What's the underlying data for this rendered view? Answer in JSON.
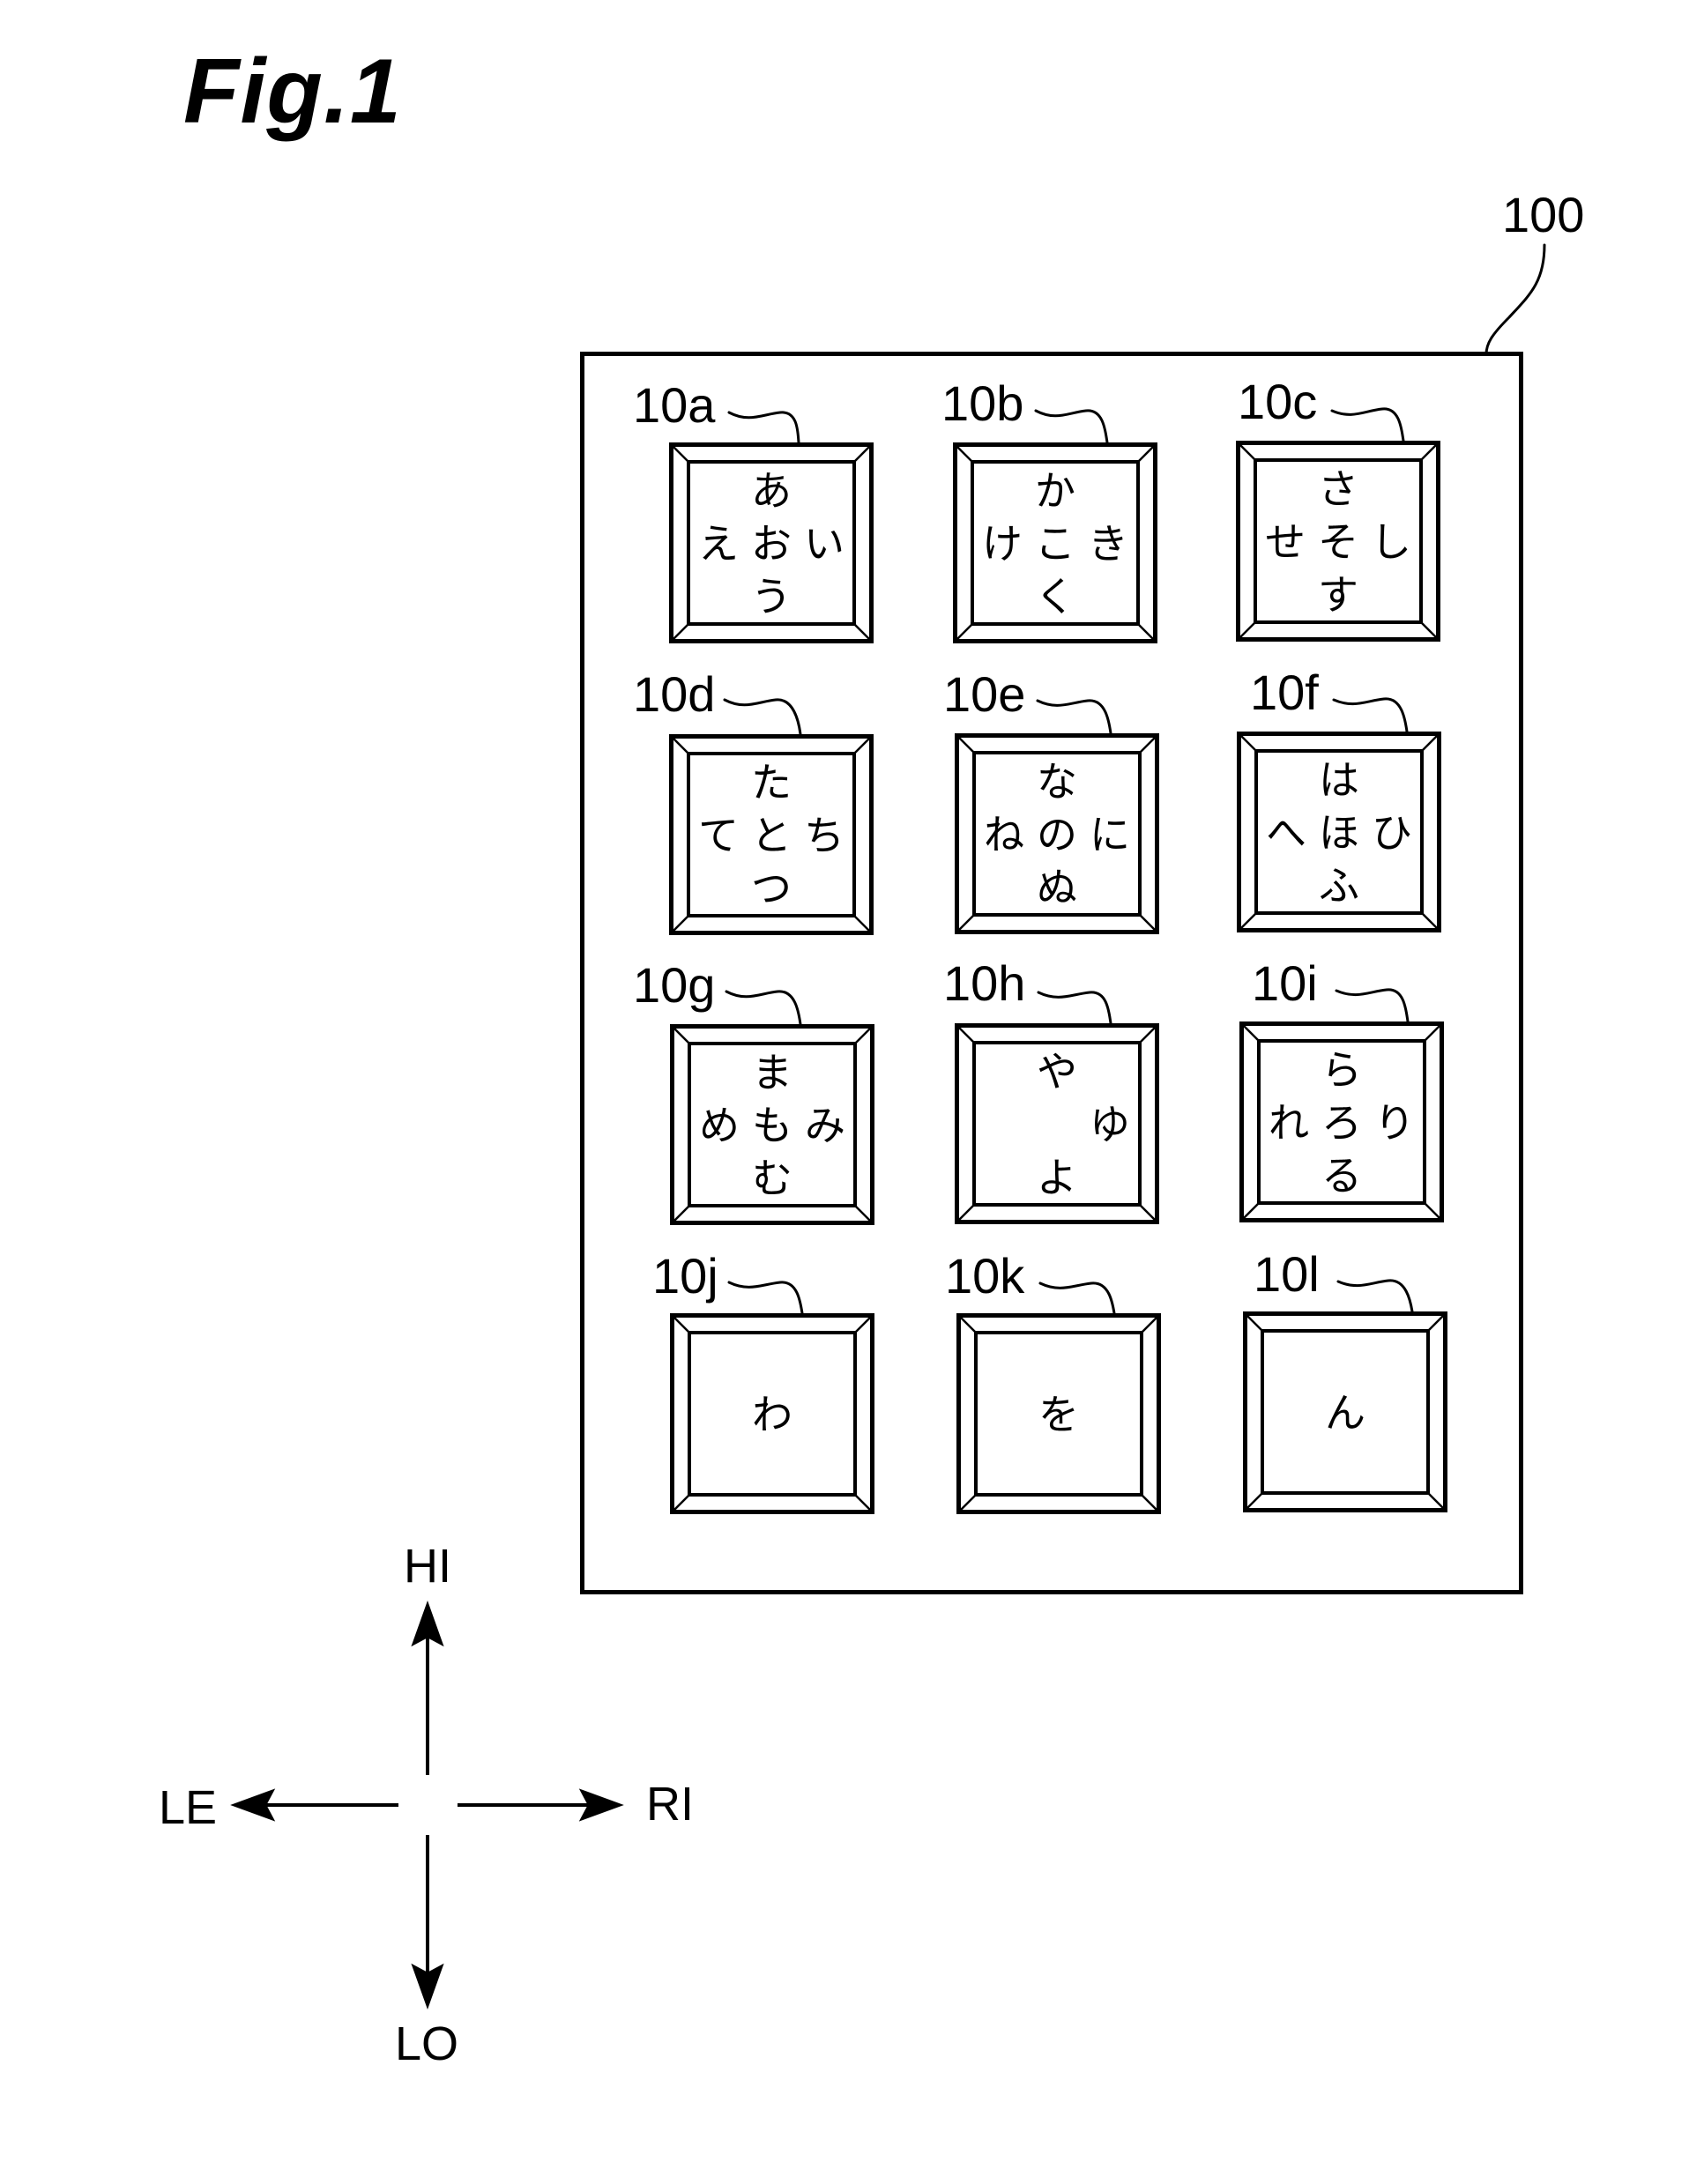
{
  "figure": {
    "title": "Fig.1",
    "board_ref": "100"
  },
  "keys": [
    {
      "ref": "10a",
      "top": "あ",
      "left": "え",
      "center": "お",
      "right": "い",
      "bottom": "う"
    },
    {
      "ref": "10b",
      "top": "か",
      "left": "け",
      "center": "こ",
      "right": "き",
      "bottom": "く"
    },
    {
      "ref": "10c",
      "top": "さ",
      "left": "せ",
      "center": "そ",
      "right": "し",
      "bottom": "す"
    },
    {
      "ref": "10d",
      "top": "た",
      "left": "て",
      "center": "と",
      "right": "ち",
      "bottom": "つ"
    },
    {
      "ref": "10e",
      "top": "な",
      "left": "ね",
      "center": "の",
      "right": "に",
      "bottom": "ぬ"
    },
    {
      "ref": "10f",
      "top": "は",
      "left": "へ",
      "center": "ほ",
      "right": "ひ",
      "bottom": "ふ"
    },
    {
      "ref": "10g",
      "top": "ま",
      "left": "め",
      "center": "も",
      "right": "み",
      "bottom": "む"
    },
    {
      "ref": "10h",
      "top": "や",
      "left": "",
      "center": "",
      "right": "ゆ",
      "bottom": "よ"
    },
    {
      "ref": "10i",
      "top": "ら",
      "left": "れ",
      "center": "ろ",
      "right": "り",
      "bottom": "る"
    },
    {
      "ref": "10j",
      "single": "わ"
    },
    {
      "ref": "10k",
      "single": "を"
    },
    {
      "ref": "10l",
      "single": "ん"
    }
  ],
  "directions": {
    "up": "HI",
    "down": "LO",
    "left": "LE",
    "right": "RI"
  }
}
